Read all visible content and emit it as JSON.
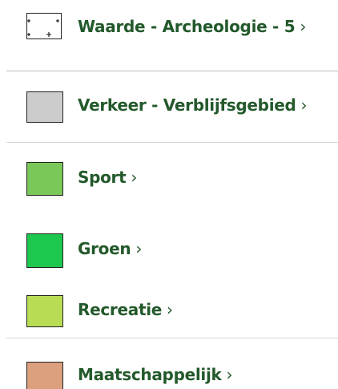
{
  "legend": {
    "items": [
      {
        "label": "Waarde - Archeologie - 5",
        "chevron": "›",
        "fill": "#ffffff",
        "pattern": "plus-marks",
        "icon": "archeology-pattern-icon"
      },
      {
        "label": "Verkeer - Verblijfsgebied",
        "chevron": "›",
        "fill": "#cccccc",
        "icon": "swatch"
      },
      {
        "label": "Sport",
        "chevron": "›",
        "fill": "#7ac85a",
        "icon": "swatch"
      },
      {
        "label": "Groen",
        "chevron": "›",
        "fill": "#1ec84f",
        "icon": "swatch"
      },
      {
        "label": "Recreatie",
        "chevron": "›",
        "fill": "#b8dd55",
        "icon": "swatch"
      },
      {
        "label": "Maatschappelijk",
        "chevron": "›",
        "fill": "#dca07f",
        "icon": "swatch"
      }
    ]
  },
  "colors": {
    "label_text": "#23592b",
    "swatch_border": "#222222",
    "divider": "#d7d7d7"
  }
}
